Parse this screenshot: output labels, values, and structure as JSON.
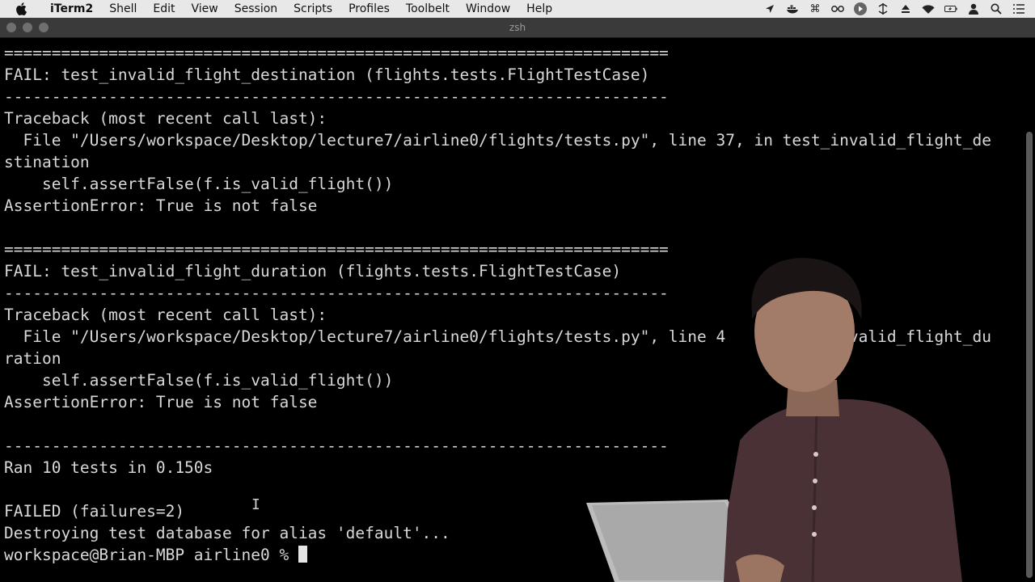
{
  "menubar": {
    "app_name": "iTerm2",
    "items": [
      "Shell",
      "Edit",
      "View",
      "Session",
      "Scripts",
      "Profiles",
      "Toolbelt",
      "Window",
      "Help"
    ],
    "status_icons": [
      "location-icon",
      "docker-icon",
      "command-icon",
      "glasses-icon",
      "play-icon",
      "network-icon",
      "eject-icon",
      "wifi-icon",
      "battery-icon",
      "user-icon",
      "search-icon",
      "list-icon"
    ]
  },
  "window": {
    "title": "zsh"
  },
  "terminal": {
    "lines": [
      "======================================================================",
      "FAIL: test_invalid_flight_destination (flights.tests.FlightTestCase)",
      "----------------------------------------------------------------------",
      "Traceback (most recent call last):",
      "  File \"/Users/workspace/Desktop/lecture7/airline0/flights/tests.py\", line 37, in test_invalid_flight_de",
      "stination",
      "    self.assertFalse(f.is_valid_flight())",
      "AssertionError: True is not false",
      "",
      "======================================================================",
      "FAIL: test_invalid_flight_duration (flights.tests.FlightTestCase)",
      "----------------------------------------------------------------------",
      "Traceback (most recent call last):",
      "  File \"/Users/workspace/Desktop/lecture7/airline0/flights/tests.py\", line 4          .invalid_flight_du",
      "ration",
      "    self.assertFalse(f.is_valid_flight())",
      "AssertionError: True is not false",
      "",
      "----------------------------------------------------------------------",
      "Ran 10 tests in 0.150s",
      "",
      "FAILED (failures=2)",
      "Destroying test database for alias 'default'...",
      "workspace@Brian-MBP airline0 % "
    ]
  },
  "colors": {
    "terminal_bg": "#000000",
    "terminal_fg": "#d8d8d8",
    "menubar_bg": "#e8e8e8",
    "titlebar_bg": "#3a3a3a"
  }
}
